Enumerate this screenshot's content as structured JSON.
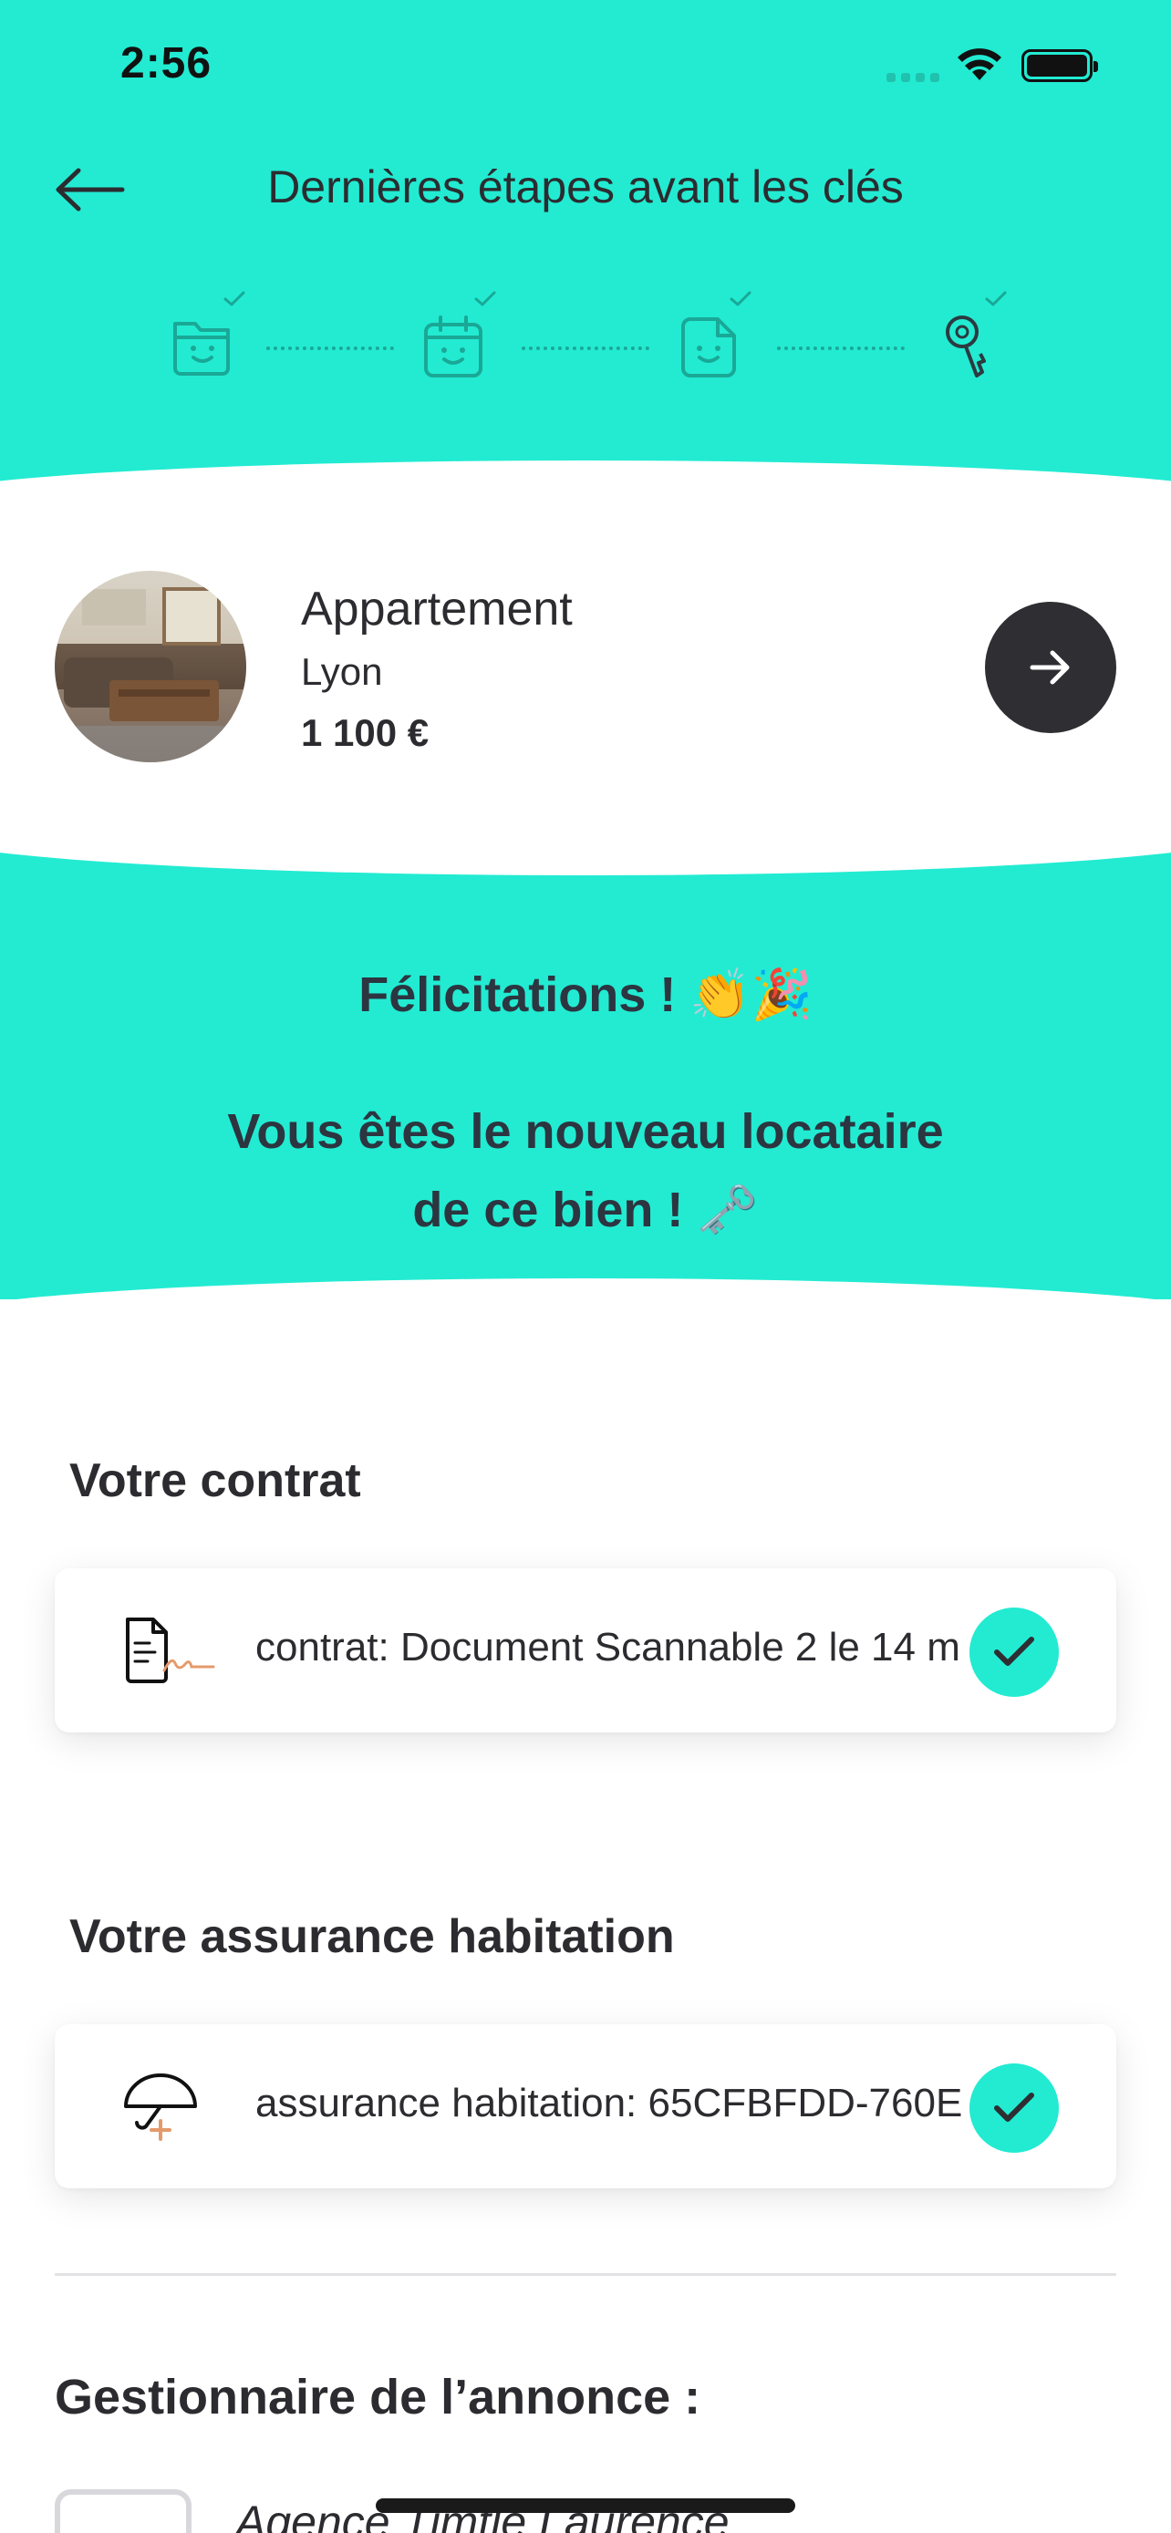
{
  "status_bar": {
    "time": "2:56"
  },
  "nav": {
    "title": "Dernières étapes avant les clés"
  },
  "steps": [
    {
      "icon": "folder-smile-icon",
      "done": true
    },
    {
      "icon": "calendar-smile-icon",
      "done": true
    },
    {
      "icon": "document-smile-icon",
      "done": true
    },
    {
      "icon": "key-icon",
      "done": true
    }
  ],
  "property": {
    "type": "Appartement",
    "city": "Lyon",
    "price": "1 100 €"
  },
  "congrats": {
    "title": "Félicitations !",
    "title_emoji": "👏🎉",
    "line1": "Vous êtes le nouveau locataire",
    "line2": "de ce bien !",
    "line2_emoji": "🗝️"
  },
  "contract": {
    "section_title": "Votre contrat",
    "doc_label": "contrat: Document Scannable 2 le 14 m"
  },
  "insurance": {
    "section_title": "Votre assurance habitation",
    "doc_label": "assurance habitation: 65CFBFDD-760E"
  },
  "manager": {
    "title": "Gestionnaire de l’annonce :",
    "agency_name": "Agence Timtle Laurence"
  },
  "colors": {
    "accent": "#22ebd2",
    "dark": "#2e2e33",
    "step_icon": "#1aa896",
    "signature": "#e59a6b"
  }
}
